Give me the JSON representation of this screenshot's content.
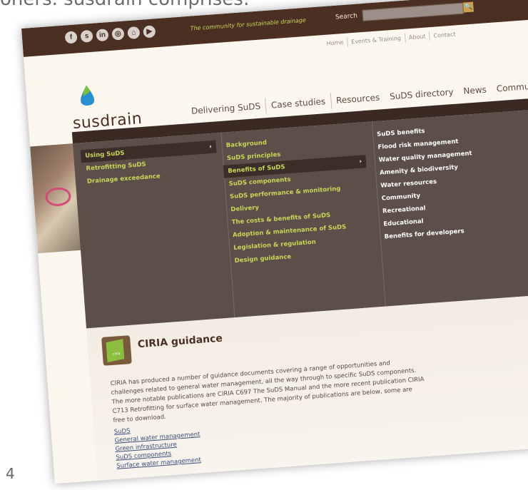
{
  "slide": {
    "caption": "oners. susdrain comprises:",
    "page_number": "4"
  },
  "topbar": {
    "social_icons": [
      "facebook-icon",
      "skype-icon",
      "linkedin-icon",
      "rss-icon",
      "share-icon",
      "youtube-icon"
    ],
    "social_glyphs": [
      "f",
      "s",
      "in",
      "◎",
      "⌂",
      "▶"
    ],
    "tagline": "The community for sustainable drainage",
    "search_label": "Search",
    "search_icon": "🔍"
  },
  "utilnav": [
    "Home",
    "Events & Training",
    "About",
    "Contact"
  ],
  "logo": {
    "text": "susdrain",
    "drop_color": "#2a8fd1",
    "drop_top_color": "#7bbf3a"
  },
  "mainnav": [
    "Delivering SuDS",
    "Case studies",
    "Resources",
    "SuDS directory",
    "News",
    "Communit"
  ],
  "mega": {
    "col1": [
      {
        "label": "Using SuDS",
        "arrow": "›"
      },
      {
        "label": "Retrofitting SuDS",
        "arrow": ""
      },
      {
        "label": "Drainage exceedance",
        "arrow": ""
      }
    ],
    "col2": [
      {
        "label": "Background",
        "arrow": ""
      },
      {
        "label": "SuDS principles",
        "arrow": ""
      },
      {
        "label": "Benefits of SuDS",
        "arrow": "›"
      },
      {
        "label": "SuDS components",
        "arrow": ""
      },
      {
        "label": "SuDS performance & monitoring",
        "arrow": ""
      },
      {
        "label": "Delivery",
        "arrow": ""
      },
      {
        "label": "The costs & benefits of SuDS",
        "arrow": ""
      },
      {
        "label": "Adoption & maintenance of SuDS",
        "arrow": ""
      },
      {
        "label": "Legislation & regulation",
        "arrow": ""
      },
      {
        "label": "Design guidance",
        "arrow": ""
      }
    ],
    "col3": [
      "SuDS benefits",
      "Flood risk management",
      "Water quality management",
      "Amenity & biodiversity",
      "Water resources",
      "Community",
      "Recreational",
      "Educational",
      "Benefits for developers"
    ]
  },
  "ciria": {
    "icon_text": "ciria",
    "title": "CIRIA guidance",
    "body": "CIRIA has produced a number of guidance documents covering a range of opportunities and challenges related to general water management, all the way through to specific SuDS components. The more notable publications are CIRIA C697 The SuDS Manual and the more recent publication CIRIA C713 Retrofitting for surface water management. The majority of publications are below, some are free to download.",
    "links": [
      "SuDS",
      "General water management",
      "Green infrastructure",
      "SuDS components",
      "Surface water management"
    ]
  }
}
